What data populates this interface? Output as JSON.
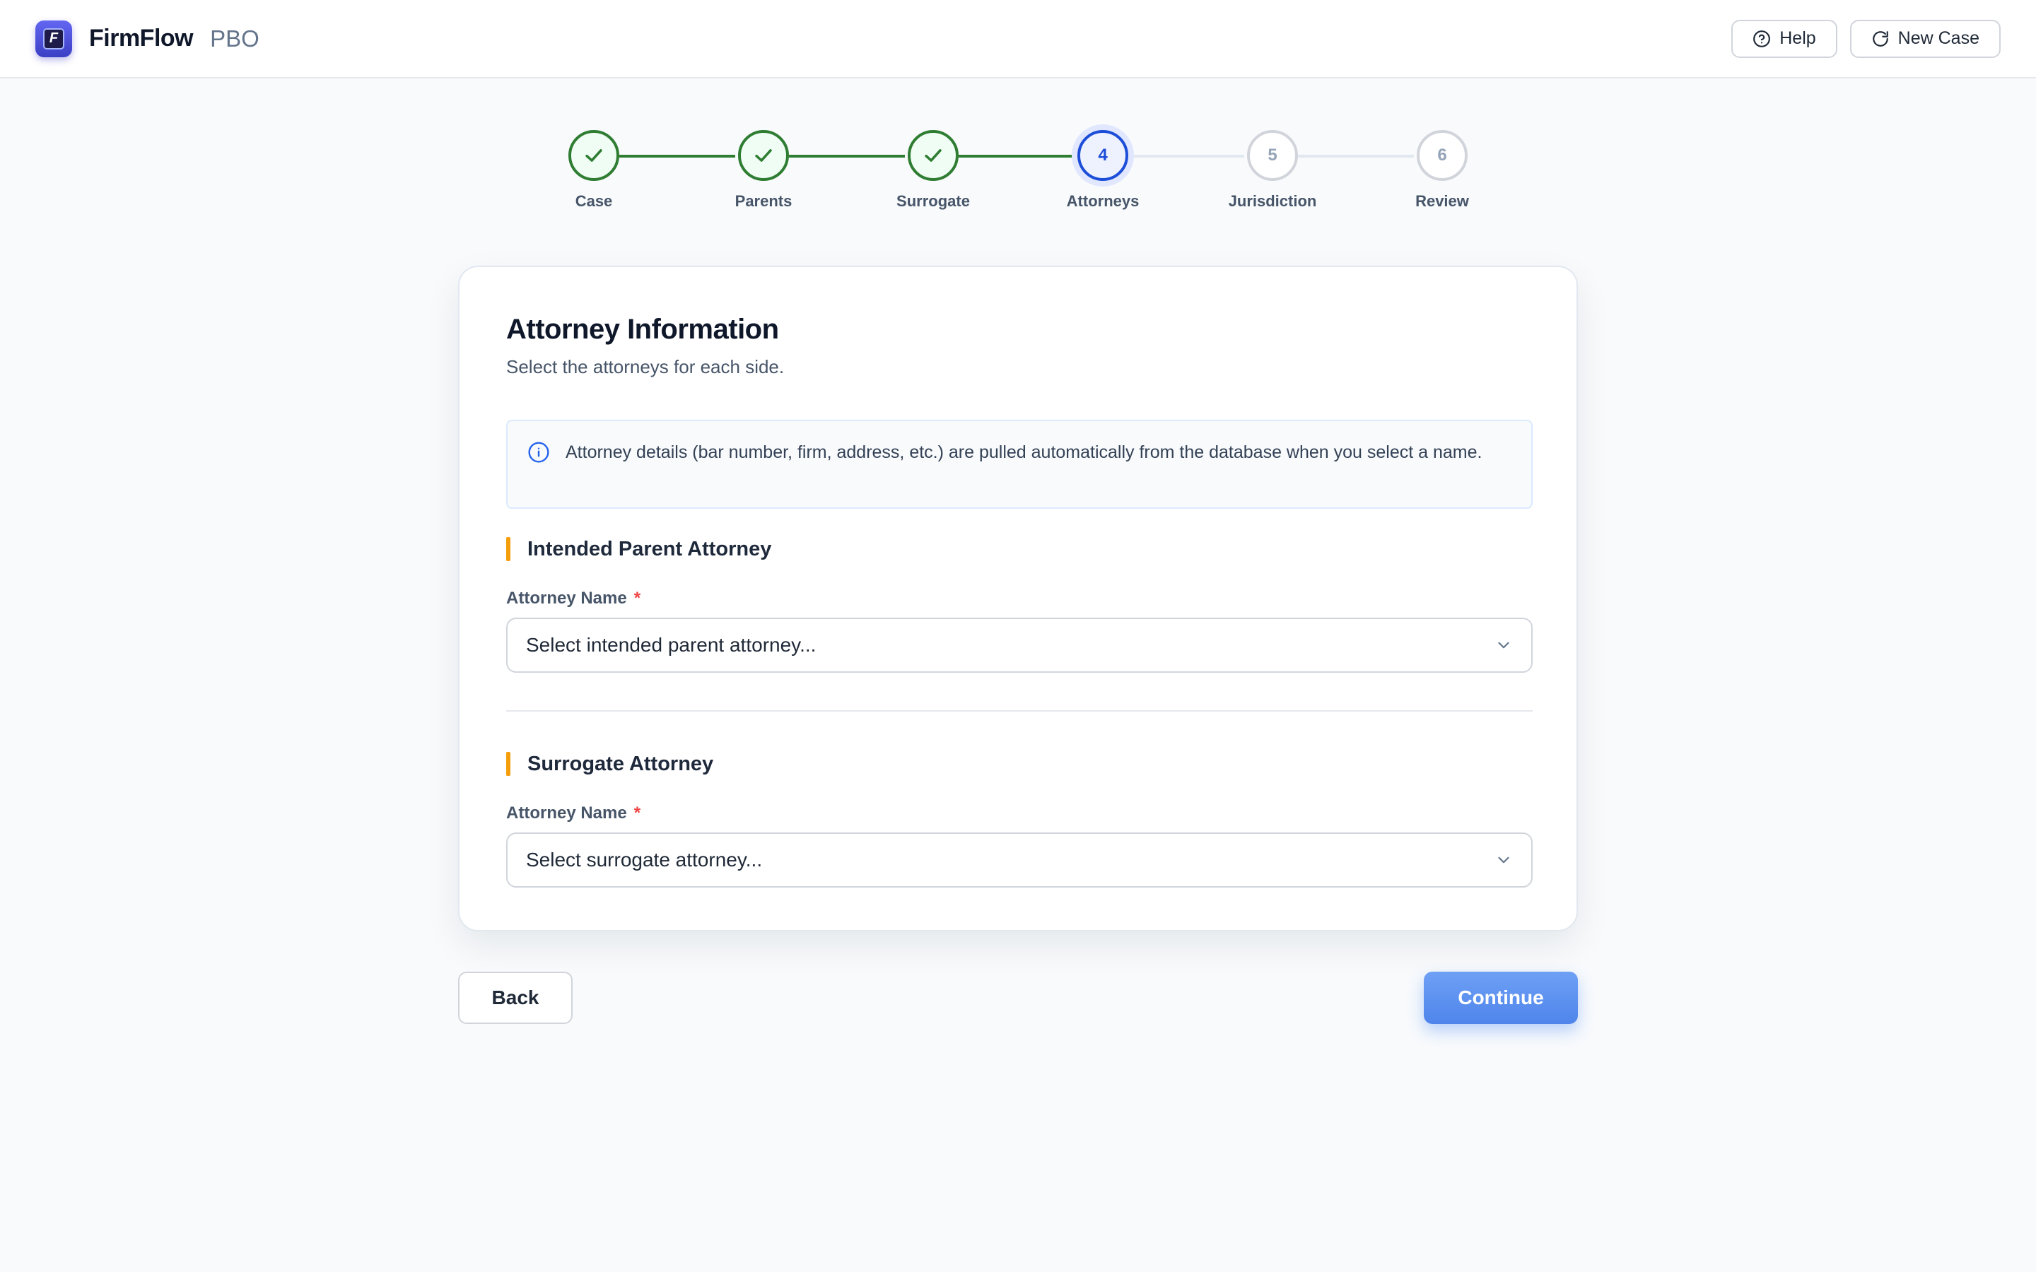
{
  "header": {
    "brand_name": "FirmFlow",
    "brand_sub": "PBO",
    "logo_letter": "F",
    "help_label": "Help",
    "new_case_label": "New Case"
  },
  "stepper": {
    "current_step": 4,
    "steps": [
      {
        "number": "1",
        "label": "Case",
        "status": "done"
      },
      {
        "number": "2",
        "label": "Parents",
        "status": "done"
      },
      {
        "number": "3",
        "label": "Surrogate",
        "status": "done"
      },
      {
        "number": "4",
        "label": "Attorneys",
        "status": "current"
      },
      {
        "number": "5",
        "label": "Jurisdiction",
        "status": "pending"
      },
      {
        "number": "6",
        "label": "Review",
        "status": "pending"
      }
    ]
  },
  "card": {
    "title": "Attorney Information",
    "subtitle": "Select the attorneys for each side.",
    "info_text": "Attorney details (bar number, firm, address, etc.) are pulled automatically from the database when you select a name.",
    "sections": [
      {
        "title": "Intended Parent Attorney",
        "field_label": "Attorney Name",
        "required_mark": "*",
        "select_placeholder": "Select intended parent attorney..."
      },
      {
        "title": "Surrogate Attorney",
        "field_label": "Attorney Name",
        "required_mark": "*",
        "select_placeholder": "Select surrogate attorney..."
      }
    ]
  },
  "footer": {
    "back_label": "Back",
    "continue_label": "Continue"
  },
  "colors": {
    "done": "#2f7d32",
    "current": "#1d4ed8",
    "pending": "#d1d5db",
    "accent_bar": "#f59e0b",
    "primary_button": "#5b8ef0",
    "required": "#ef4444"
  }
}
